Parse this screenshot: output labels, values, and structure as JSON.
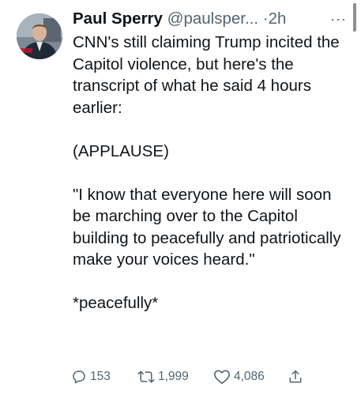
{
  "tweet": {
    "author_name": "Paul Sperry",
    "handle": "@paulsper...",
    "separator": "·",
    "time": "2h",
    "more_icon": "more-horizontal-icon",
    "body": {
      "p1": "CNN's still claiming Trump incited the Capitol violence, but here's the transcript of what he said 4 hours earlier:",
      "p2": "(APPLAUSE)",
      "p3": "\"I know that everyone here will soon be marching over to the Capitol building to peacefully and patriotically make your voices heard.\"",
      "p4": "*peacefully*"
    },
    "actions": {
      "reply_icon": "reply-icon",
      "replies": "153",
      "retweet_icon": "retweet-icon",
      "retweets": "1,999",
      "like_icon": "heart-icon",
      "likes": "4,086",
      "share_icon": "share-icon"
    }
  },
  "colors": {
    "text": "#0f1419",
    "secondary": "#536471",
    "background": "#ffffff"
  }
}
